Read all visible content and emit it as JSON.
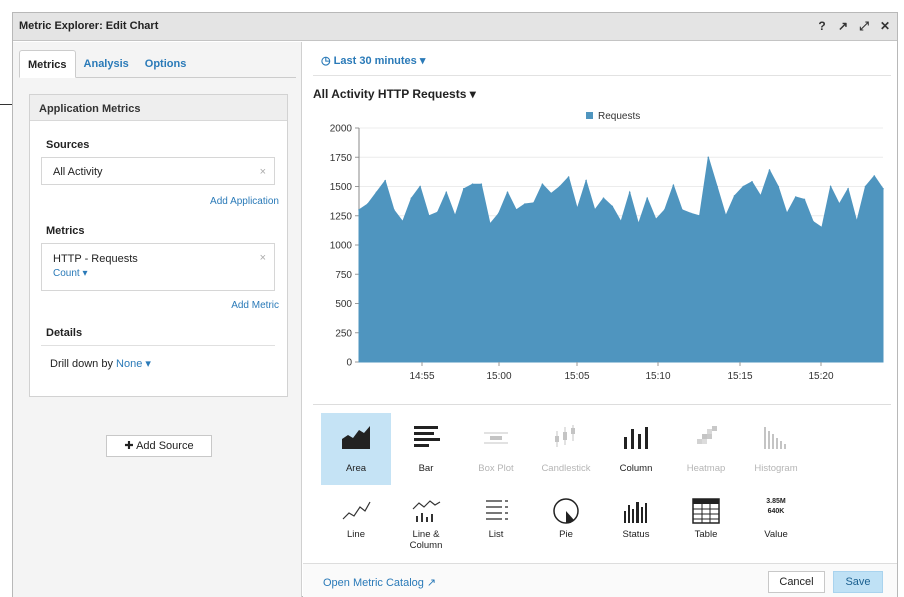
{
  "window": {
    "title": "Metric Explorer: Edit Chart",
    "icons": [
      {
        "name": "help-icon",
        "glyph": "?"
      },
      {
        "name": "external-link-icon",
        "glyph": "↗"
      },
      {
        "name": "expand-icon",
        "glyph": "⤢"
      },
      {
        "name": "close-icon",
        "glyph": "✕"
      }
    ]
  },
  "tabs": [
    "Metrics",
    "Analysis",
    "Options"
  ],
  "application_metrics": {
    "header": "Application Metrics",
    "sources_label": "Sources",
    "source_value": "All Activity",
    "remove_glyph": "×",
    "add_application": "Add Application",
    "metrics_label": "Metrics",
    "metric_name": "HTTP - Requests",
    "metric_agg": "Count ▾",
    "add_metric": "Add Metric",
    "details_label": "Details",
    "drill_prefix": "Drill down by",
    "drill_value": "None ▾"
  },
  "add_source": "✚ Add Source",
  "time_range": "◷  Last 30 minutes  ▾",
  "chart_title": "All Activity HTTP Requests ▾",
  "chart_data": {
    "type": "area",
    "title": "All Activity HTTP Requests",
    "legend": "Requests",
    "legend_position": "top",
    "color": "#4f95bf",
    "ylim": [
      0,
      2000
    ],
    "yticks": [
      "2000",
      "1750",
      "1500",
      "1250",
      "1000",
      "750",
      "500",
      "250",
      "0"
    ],
    "xticks": [
      "14:55",
      "15:00",
      "15:05",
      "15:10",
      "15:15",
      "15:20"
    ],
    "grid": true,
    "series": [
      {
        "name": "Requests",
        "values": [
          1300,
          1350,
          1450,
          1550,
          1300,
          1200,
          1400,
          1500,
          1250,
          1280,
          1450,
          1250,
          1480,
          1520,
          1520,
          1180,
          1270,
          1450,
          1300,
          1350,
          1360,
          1520,
          1440,
          1500,
          1580,
          1310,
          1550,
          1300,
          1400,
          1330,
          1200,
          1450,
          1180,
          1400,
          1220,
          1300,
          1510,
          1300,
          1270,
          1250,
          1750,
          1500,
          1250,
          1420,
          1500,
          1540,
          1420,
          1640,
          1500,
          1270,
          1410,
          1390,
          1200,
          1150,
          1500,
          1350,
          1480,
          1200,
          1500,
          1590,
          1480
        ]
      }
    ]
  },
  "visualizations": [
    {
      "label": "Area",
      "icon": "area-chart-icon"
    },
    {
      "label": "Bar",
      "icon": "bar-chart-icon"
    },
    {
      "label": "Box Plot",
      "icon": "box-plot-icon"
    },
    {
      "label": "Candlestick",
      "icon": "candlestick-icon"
    },
    {
      "label": "Column",
      "icon": "column-chart-icon"
    },
    {
      "label": "Heatmap",
      "icon": "heatmap-icon"
    },
    {
      "label": "Histogram",
      "icon": "histogram-icon"
    },
    {
      "label": "Line",
      "icon": "line-chart-icon"
    },
    {
      "label": "Line &",
      "label2": "Column",
      "icon": "line-column-icon"
    },
    {
      "label": "List",
      "icon": "list-icon"
    },
    {
      "label": "Pie",
      "icon": "pie-chart-icon"
    },
    {
      "label": "Status",
      "icon": "status-icon"
    },
    {
      "label": "Table",
      "icon": "table-icon"
    },
    {
      "label": "Value",
      "icon": "value-icon",
      "value_lines": [
        "3.85M",
        "640K"
      ]
    }
  ],
  "footer": {
    "catalog": "Open Metric Catalog ↗",
    "cancel": "Cancel",
    "save": "Save"
  }
}
